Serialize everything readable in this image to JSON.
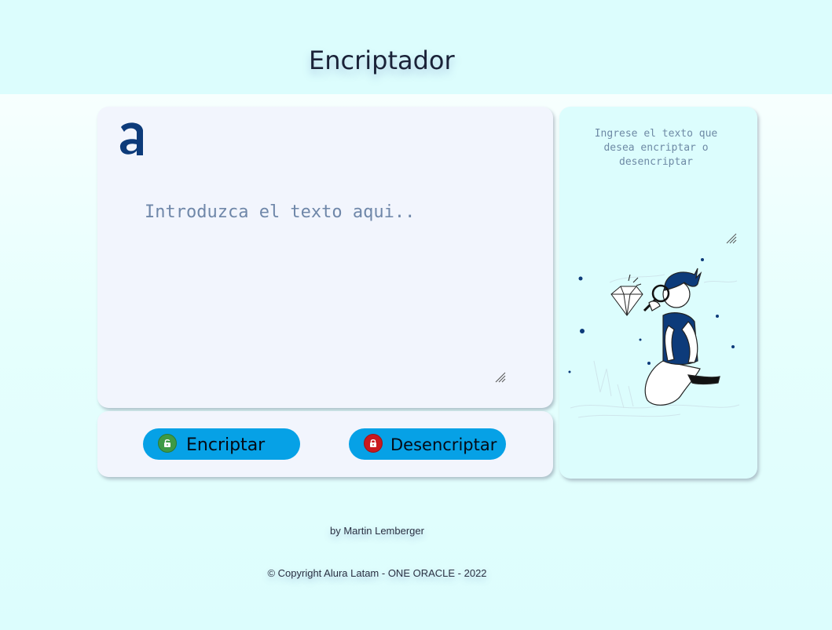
{
  "header": {
    "title": "Encriptador"
  },
  "brand": {
    "logo_icon": "alura-a-logo-icon",
    "color": "#0d3b7a"
  },
  "editor": {
    "placeholder": "Introduzca el texto aqui..",
    "value": ""
  },
  "actions": {
    "encrypt_label": "Encriptar",
    "encrypt_icon": "unlocked-padlock-icon",
    "decrypt_label": "Desencriptar",
    "decrypt_icon": "locked-padlock-icon",
    "button_color": "#06a1e6"
  },
  "output": {
    "placeholder": "Ingrese el texto que desea encriptar o desencriptar",
    "illustration": "person-inspecting-diamond-illustration"
  },
  "footer": {
    "author": "by Martin Lemberger",
    "copyright": "© Copyright Alura Latam - ONE ORACLE - 2022"
  }
}
